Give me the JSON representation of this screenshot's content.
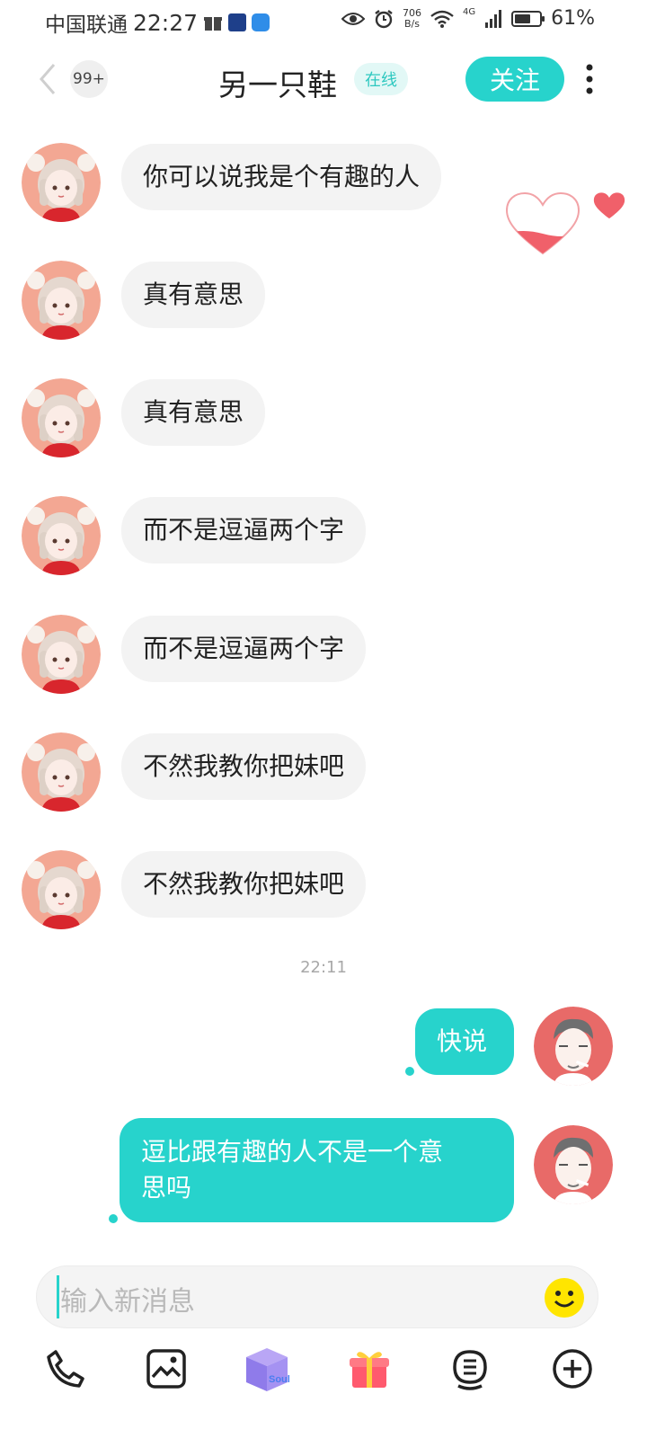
{
  "status_bar": {
    "carrier": "中国联通",
    "time": "22:27",
    "net_speed_value": "706",
    "net_speed_unit": "B/s",
    "network": "4G",
    "battery": "61%"
  },
  "header": {
    "unread_badge": "99+",
    "contact_name": "另一只鞋",
    "status": "在线",
    "follow_label": "关注",
    "icons": [
      "back-chevron-icon",
      "more-vertical-icon"
    ]
  },
  "messages": [
    {
      "side": "in",
      "text": "你可以说我是个有趣的人"
    },
    {
      "side": "in",
      "text": "真有意思"
    },
    {
      "side": "in",
      "text": "真有意思"
    },
    {
      "side": "in",
      "text": "而不是逗逼两个字"
    },
    {
      "side": "in",
      "text": "而不是逗逼两个字"
    },
    {
      "side": "in",
      "text": "不然我教你把妹吧"
    },
    {
      "side": "in",
      "text": "不然我教你把妹吧"
    },
    {
      "timestamp": "22:11"
    },
    {
      "side": "out",
      "text": "快说"
    },
    {
      "side": "out",
      "text_lines": [
        "逗比跟有趣的人不是一个意",
        "思吗"
      ]
    }
  ],
  "intimacy": {
    "heart_fill": 0.35
  },
  "input": {
    "placeholder": "输入新消息"
  },
  "toolbar": {
    "icons": [
      "phone-icon",
      "image-icon",
      "soul-box-icon",
      "gift-icon",
      "voice-match-icon",
      "add-circle-icon"
    ],
    "soul_box_text": "Soul"
  },
  "colors": {
    "accent": "#27d3cc",
    "incoming_bubble": "#f3f3f3",
    "heart": "#f0606a",
    "follow_bg": "#27d3cc"
  }
}
